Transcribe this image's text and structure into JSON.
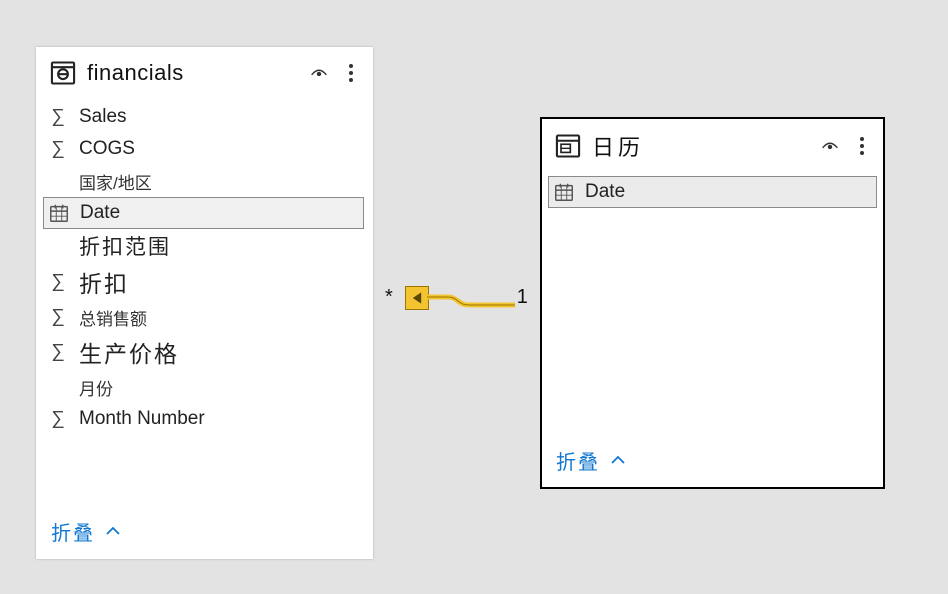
{
  "tables": {
    "financials": {
      "title": "financials",
      "fields": [
        {
          "icon": "sigma",
          "label": "Sales",
          "style": "normal"
        },
        {
          "icon": "sigma",
          "label": "COGS",
          "style": "normal"
        },
        {
          "icon": "none",
          "label": "国家/地区",
          "style": "smalltext"
        },
        {
          "icon": "calendar",
          "label": "Date",
          "style": "normal",
          "selected": true
        },
        {
          "icon": "none",
          "label": "折扣范围",
          "style": "midtext"
        },
        {
          "icon": "sigma",
          "label": "折扣",
          "style": "bigtext"
        },
        {
          "icon": "sigma",
          "label": "总销售额",
          "style": "smalltext"
        },
        {
          "icon": "sigma",
          "label": "生产价格",
          "style": "bigtext"
        },
        {
          "icon": "none",
          "label": "月份",
          "style": "smalltext"
        },
        {
          "icon": "sigma",
          "label": "Month Number",
          "style": "normal"
        }
      ],
      "collapse": "折叠"
    },
    "calendar": {
      "title": "日历",
      "fields": [
        {
          "icon": "calendar",
          "label": "Date",
          "style": "normal",
          "selected": true
        }
      ],
      "collapse": "折叠"
    }
  },
  "relationship": {
    "left_cardinality": "*",
    "right_cardinality": "1"
  }
}
